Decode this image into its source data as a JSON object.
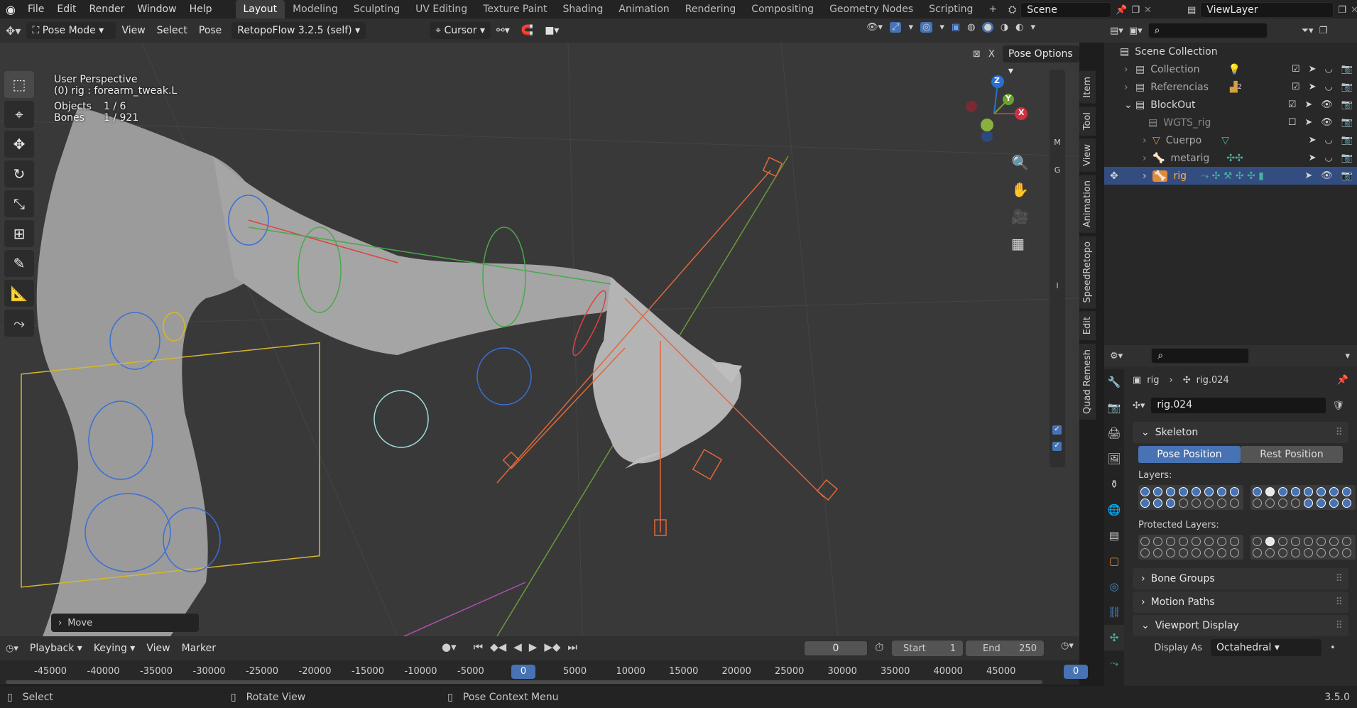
{
  "topbar": {
    "menus": [
      "File",
      "Edit",
      "Render",
      "Window",
      "Help"
    ],
    "workspaces": [
      "Layout",
      "Modeling",
      "Sculpting",
      "UV Editing",
      "Texture Paint",
      "Shading",
      "Animation",
      "Rendering",
      "Compositing",
      "Geometry Nodes",
      "Scripting"
    ],
    "active_workspace": "Layout",
    "add_tab": "+",
    "scene": "Scene",
    "view_layer": "ViewLayer"
  },
  "viewport_header": {
    "mode": "Pose Mode",
    "menus": [
      "View",
      "Select",
      "Pose"
    ],
    "addon": "RetopoFlow 3.2.5 (self)",
    "pivot": "Cursor",
    "pose_options": "Pose Options",
    "x_label": "X"
  },
  "viewport_overlay": {
    "perspective": "User Perspective",
    "active": "(0) rig : forearm_tweak.L",
    "objects_label": "Objects",
    "objects_value": "1 / 6",
    "bones_label": "Bones",
    "bones_value": "1 / 921",
    "last_op": "Move",
    "axis_z": "Z",
    "axis_y": "Y",
    "axis_x": "X",
    "letters": [
      "M",
      "G",
      "I"
    ]
  },
  "sidebar_tabs": [
    "Item",
    "Tool",
    "View",
    "Animation",
    "SpeedRetopo",
    "Edit",
    "Quad Remesh"
  ],
  "outliner": {
    "root": "Scene Collection",
    "rows": [
      {
        "label": "Collection",
        "sel": false
      },
      {
        "label": "Referencias",
        "sel": false
      },
      {
        "label": "BlockOut",
        "sel": false
      },
      {
        "label": "WGTS_rig",
        "sel": false
      },
      {
        "label": "Cuerpo",
        "sel": false
      },
      {
        "label": "metarig",
        "sel": false
      },
      {
        "label": "rig",
        "sel": true
      }
    ],
    "ref_count": "2"
  },
  "properties": {
    "breadcrumb_obj": "rig",
    "breadcrumb_data": "rig.024",
    "data_name": "rig.024",
    "skeleton_label": "Skeleton",
    "pose_position": "Pose Position",
    "rest_position": "Rest Position",
    "layers_label": "Layers:",
    "protected_label": "Protected Layers:",
    "panels": [
      "Bone Groups",
      "Motion Paths",
      "Viewport Display"
    ],
    "display_as_label": "Display As",
    "display_as_value": "Octahedral",
    "layers_row1_left": [
      1,
      1,
      1,
      1,
      1,
      1,
      1,
      1
    ],
    "layers_row2_left": [
      1,
      1,
      1,
      0,
      0,
      0,
      0,
      0
    ],
    "layers_row1_right": [
      1,
      2,
      1,
      1,
      1,
      1,
      1,
      1
    ],
    "layers_row2_right": [
      0,
      0,
      0,
      0,
      1,
      1,
      1,
      1
    ],
    "prot_row1_left": [
      0,
      0,
      0,
      0,
      0,
      0,
      0,
      0
    ],
    "prot_row2_left": [
      0,
      0,
      0,
      0,
      0,
      0,
      0,
      0
    ],
    "prot_row1_right": [
      0,
      2,
      0,
      0,
      0,
      0,
      0,
      0
    ],
    "prot_row2_right": [
      0,
      0,
      0,
      0,
      0,
      0,
      0,
      0
    ]
  },
  "timeline": {
    "menus": [
      "Playback",
      "Keying",
      "View",
      "Marker"
    ],
    "current_frame": "0",
    "start_label": "Start",
    "start_value": "1",
    "end_label": "End",
    "end_value": "250",
    "ruler": [
      "-45000",
      "-40000",
      "-35000",
      "-30000",
      "-25000",
      "-20000",
      "-15000",
      "-10000",
      "-5000",
      "0",
      "5000",
      "10000",
      "15000",
      "20000",
      "25000",
      "30000",
      "35000",
      "40000",
      "45000"
    ],
    "right_frame": "0"
  },
  "statusbar": {
    "select": "Select",
    "rotate": "Rotate View",
    "context": "Pose Context Menu",
    "version": "3.5.0"
  }
}
